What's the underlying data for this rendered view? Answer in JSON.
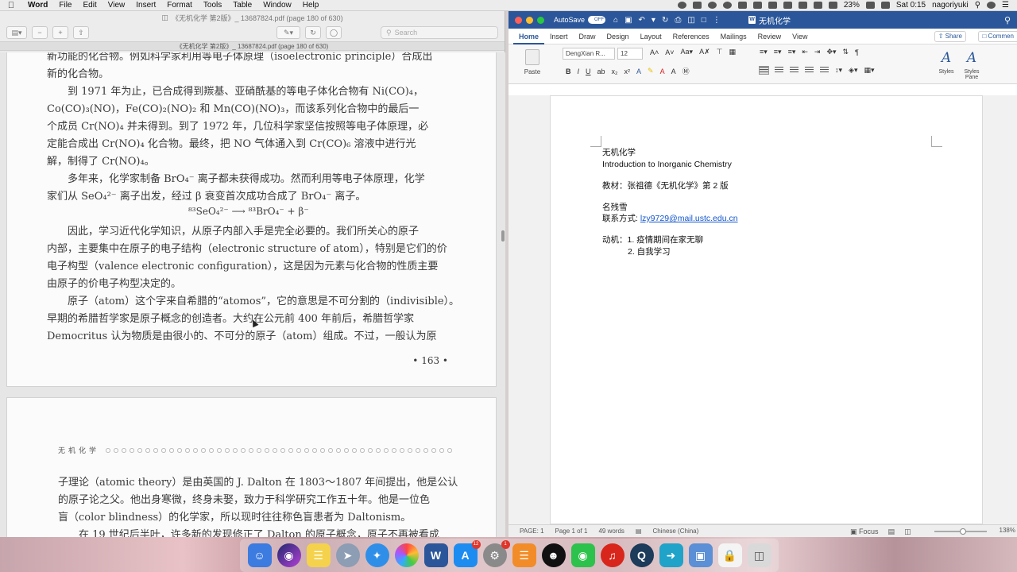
{
  "menubar": {
    "app_name": "Word",
    "items": [
      "File",
      "Edit",
      "View",
      "Insert",
      "Format",
      "Tools",
      "Table",
      "Window",
      "Help"
    ],
    "battery": "23%",
    "clock": "Sat 0:15",
    "user": "nagoriyuki"
  },
  "pdf": {
    "window_title": "《无机化学 第2版》_ 13687824.pdf (page 180 of 630)",
    "tab_title": "《无机化学 第2版》_ 13687824.pdf (page 180 of 630)",
    "search_placeholder": "Search",
    "page_a_lines": [
      "新功能的化合物。例如科学家利用等电子体原理（isoelectronic principle）合成出",
      "新的化合物。",
      "　　到 1971 年为止，已合成得到羰基、亚硝酰基的等电子体化合物有 Ni(CO)₄，",
      "Co(CO)₃(NO)，Fe(CO)₂(NO)₂ 和 Mn(CO)(NO)₃，而该系列化合物中的最后一",
      "个成员 Cr(NO)₄ 并未得到。到了 1972 年，几位科学家坚信按照等电子体原理，必",
      "定能合成出 Cr(NO)₄ 化合物。最终，把 NO 气体通入到 Cr(CO)₆ 溶液中进行光",
      "解，制得了 Cr(NO)₄。",
      "　　多年来，化学家制备 BrO₄⁻ 离子都未获得成功。然而利用等电子体原理，化学",
      "家们从 SeO₄²⁻ 离子出发，经过 β 衰变首次成功合成了 BrO₄⁻ 离子。",
      "　　因此，学习近代化学知识，从原子内部入手是完全必要的。我们所关心的原子",
      "内部，主要集中在原子的电子结构（electronic structure of atom），特别是它们的价",
      "电子构型（valence electronic configuration），这是因为元素与化合物的性质主要",
      "由原子的价电子构型决定的。",
      "　　原子（atom）这个字来自希腊的“atomos”，它的意思是不可分割的（indivisible）。",
      "早期的希腊哲学家是原子概念的创造者。大约在公元前 400 年前后，希腊哲学家",
      "Democritus 认为物质是由很小的、不可分的原子（atom）组成。不过，一般认为原"
    ],
    "equation": "⁸³SeO₄²⁻ ⟶ ⁸³BrO₄⁻ + β⁻",
    "page_a_number": "• 163 •",
    "page_b_running_head": "无机化学",
    "page_b_lines": [
      "子理论（atomic theory）是由英国的 J. Dalton 在 1803～1807 年间提出，他是公认",
      "的原子论之父。他出身寒微，终身未娶，致力于科学研究工作五十年。他是一位色",
      "盲（color blindness）的化学家，所以现时往往称色盲患者为 Daltonism。",
      "　　在 19 世纪后半叶，许多新的发现修正了 Dalton 的原子概念，原子不再被看成"
    ]
  },
  "word": {
    "autosave_label": "AutoSave",
    "autosave_state": "OFF",
    "doc_title": "无机化学",
    "tabs": [
      "Home",
      "Insert",
      "Draw",
      "Design",
      "Layout",
      "References",
      "Mailings",
      "Review",
      "View"
    ],
    "share_label": "Share",
    "comments_label": "Commen",
    "paste_label": "Paste",
    "font_name": "DengXian R...",
    "font_size": "12",
    "styles_label": "Styles",
    "styles_pane_label": "Styles Pane",
    "document": {
      "line1": "无机化学",
      "line2": "Introduction to Inorganic Chemistry",
      "line3": "教材：张祖德《无机化学》第 2 版",
      "line4": "名残雪",
      "contact_label": "联系方式: ",
      "email": "lzy9729@mail.ustc.edu.cn",
      "motive_label": "动机：",
      "motive_1": "1. 疫情期间在家无聊",
      "motive_2": "2. 自我学习"
    },
    "status": {
      "page": "PAGE: 1",
      "page_of": "Page 1 of 1",
      "words": "49 words",
      "language": "Chinese (China)",
      "focus": "Focus",
      "zoom": "138%"
    }
  },
  "dock": {
    "appstore_badge": "12",
    "settings_badge": "1"
  },
  "colors": {
    "word_blue": "#2b579a",
    "link": "#1155cc",
    "close": "#ff5f57",
    "minimize": "#febc2e",
    "zoom": "#28c840"
  }
}
